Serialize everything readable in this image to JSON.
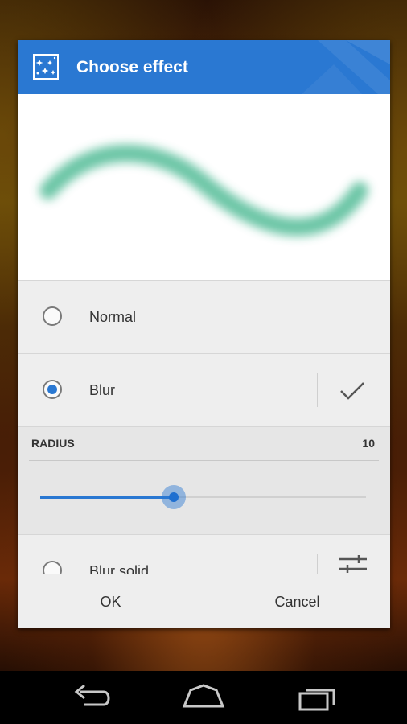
{
  "dialog": {
    "title": "Choose effect",
    "icon": "sparkle-effect-icon"
  },
  "preview": {
    "stroke_color": "#5cbf9c",
    "description_icon": "blurred-wave-stroke"
  },
  "effects": [
    {
      "label": "Normal",
      "selected": false
    },
    {
      "label": "Blur",
      "selected": true,
      "action_icon": "check-icon"
    },
    {
      "label": "Blur solid",
      "selected": false,
      "action_icon": "sliders-icon"
    }
  ],
  "radius": {
    "label": "RADIUS",
    "value": "10",
    "slider_fraction": 0.41
  },
  "buttons": {
    "ok": "OK",
    "cancel": "Cancel"
  },
  "colors": {
    "accent": "#2a78d2",
    "header": "#2a78d2",
    "list_background": "#eeeeee"
  },
  "navigation": {
    "back_icon": "back-icon",
    "home_icon": "home-icon",
    "recents_icon": "recents-icon"
  }
}
